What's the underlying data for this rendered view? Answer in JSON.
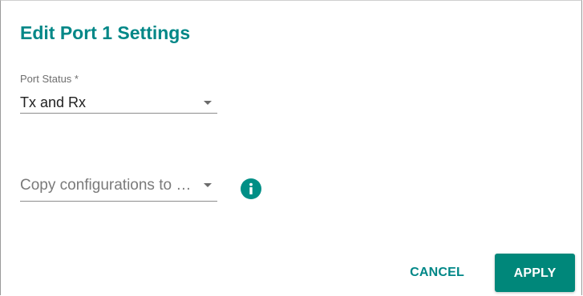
{
  "dialog": {
    "title": "Edit Port 1 Settings"
  },
  "port_status": {
    "label": "Port Status *",
    "value": "Tx and Rx"
  },
  "copy_config": {
    "placeholder": "Copy configurations to ports"
  },
  "actions": {
    "cancel_label": "CANCEL",
    "apply_label": "APPLY"
  },
  "colors": {
    "accent": "#008787",
    "button_bg": "#00877a",
    "info_icon": "#008f86"
  },
  "icons": {
    "dropdown": "caret-down-icon",
    "info": "info-icon"
  }
}
